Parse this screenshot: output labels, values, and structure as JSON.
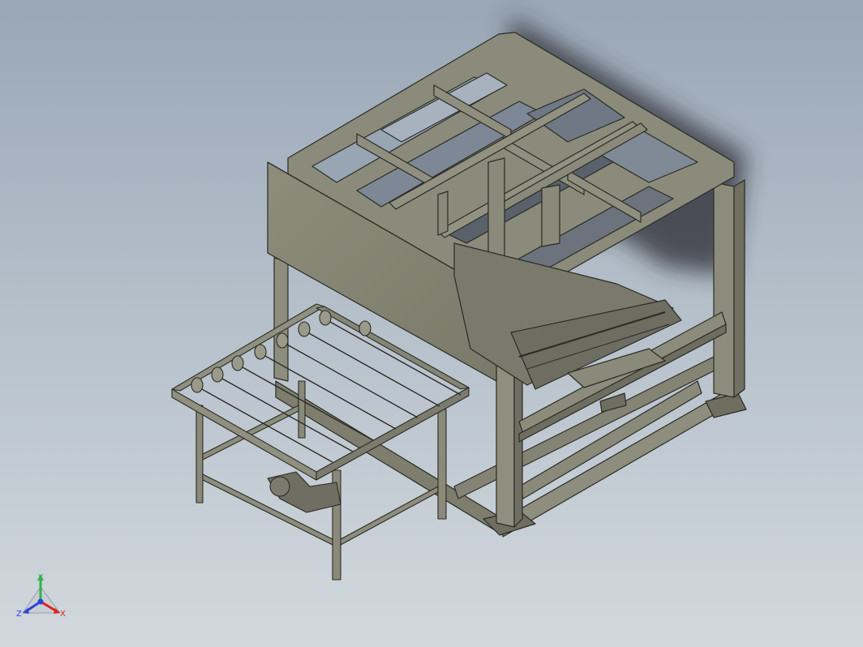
{
  "viewport": {
    "background_top": "#99a7b6",
    "background_bottom": "#d2d8dd",
    "model_color": "#8a8a7a",
    "edge_color": "#2b2b25",
    "shadow_color": "#1e2024"
  },
  "triad": {
    "x_label": "X",
    "y_label": "Y",
    "z_label": "Z",
    "x_color": "#e0201c",
    "y_color": "#2fb44a",
    "z_color": "#2a45d8"
  }
}
